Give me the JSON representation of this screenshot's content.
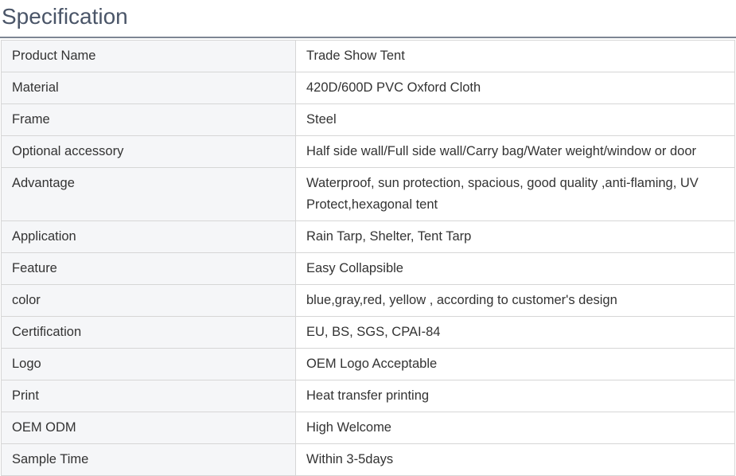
{
  "title": "Specification",
  "rows": [
    {
      "key": "Product Name",
      "value": "Trade Show Tent"
    },
    {
      "key": "Material",
      "value": "420D/600D PVC Oxford Cloth"
    },
    {
      "key": "Frame",
      "value": "Steel"
    },
    {
      "key": "Optional accessory",
      "value": "Half side wall/Full side wall/Carry bag/Water weight/window or door"
    },
    {
      "key": "Advantage",
      "value": "Waterproof, sun protection, spacious, good quality ,anti-flaming, UV Protect,hexagonal tent"
    },
    {
      "key": "Application",
      "value": "Rain Tarp, Shelter, Tent Tarp"
    },
    {
      "key": "Feature",
      "value": "Easy Collapsible"
    },
    {
      "key": "color",
      "value": "blue,gray,red, yellow , according to customer's design"
    },
    {
      "key": "Certification",
      "value": "EU, BS, SGS, CPAI-84"
    },
    {
      "key": "Logo",
      "value": "OEM Logo Acceptable"
    },
    {
      "key": "Print",
      "value": "Heat transfer printing"
    },
    {
      "key": "OEM ODM",
      "value": "High Welcome"
    },
    {
      "key": "Sample Time",
      "value": "Within 3-5days"
    }
  ]
}
